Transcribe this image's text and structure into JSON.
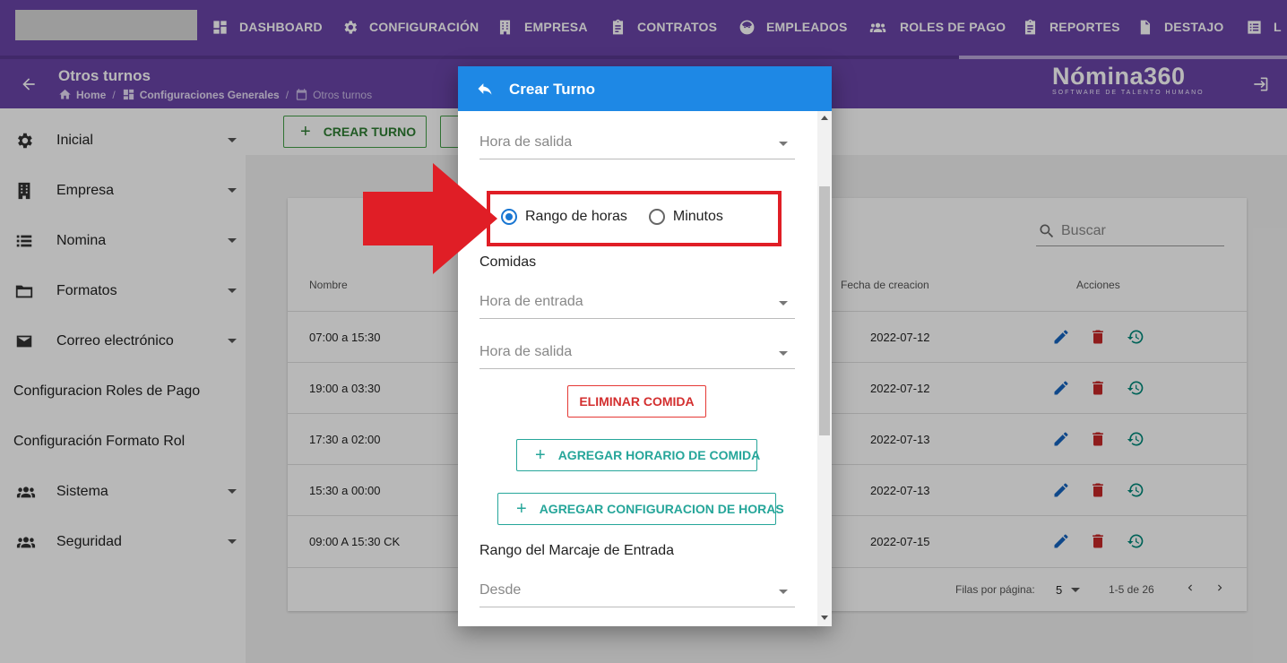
{
  "nav": {
    "items": [
      {
        "label": "DASHBOARD",
        "icon": "dashboard-icon"
      },
      {
        "label": "CONFIGURACIÓN",
        "icon": "gear-icon"
      },
      {
        "label": "EMPRESA",
        "icon": "building-icon"
      },
      {
        "label": "CONTRATOS",
        "icon": "clipboard-icon"
      },
      {
        "label": "EMPLEADOS",
        "icon": "face-icon"
      },
      {
        "label": "ROLES DE PAGO",
        "icon": "group-icon"
      },
      {
        "label": "REPORTES",
        "icon": "clipboard-icon"
      },
      {
        "label": "DESTAJO",
        "icon": "document-icon"
      },
      {
        "label": "L",
        "icon": "list-icon"
      }
    ]
  },
  "header": {
    "title": "Otros turnos",
    "breadcrumb": [
      "Home",
      "Configuraciones Generales",
      "Otros turnos"
    ],
    "brand_name": "Nómina360",
    "brand_sub": "SOFTWARE DE TALENTO HUMANO"
  },
  "sidebar": {
    "items": [
      {
        "label": "Inicial",
        "icon": "gear-icon",
        "expandable": true
      },
      {
        "label": "Empresa",
        "icon": "building-icon",
        "expandable": true
      },
      {
        "label": "Nomina",
        "icon": "list-icon",
        "expandable": true
      },
      {
        "label": "Formatos",
        "icon": "folder-icon",
        "expandable": true
      },
      {
        "label": "Correo electrónico",
        "icon": "mail-icon",
        "expandable": true
      },
      {
        "label": "Configuracion Roles de Pago",
        "icon": "",
        "expandable": false
      },
      {
        "label": "Configuración Formato Rol",
        "icon": "",
        "expandable": false
      },
      {
        "label": "Sistema",
        "icon": "group-icon",
        "expandable": true
      },
      {
        "label": "Seguridad",
        "icon": "group-icon",
        "expandable": true
      }
    ]
  },
  "toolbar": {
    "create_label": "CREAR TURNO"
  },
  "table": {
    "search_placeholder": "Buscar",
    "headers": {
      "name": "Nombre",
      "date": "Fecha de creacion",
      "actions": "Acciones"
    },
    "rows": [
      {
        "name": "07:00 a 15:30",
        "date": "2022-07-12"
      },
      {
        "name": "19:00 a 03:30",
        "date": "2022-07-12"
      },
      {
        "name": "17:30 a 02:00",
        "date": "2022-07-13"
      },
      {
        "name": "15:30 a 00:00",
        "date": "2022-07-13"
      },
      {
        "name": "09:00 A 15:30 CK",
        "date": "2022-07-15"
      }
    ],
    "footer": {
      "rows_label": "Filas por página:",
      "rows_value": "5",
      "range": "1-5 de 26"
    }
  },
  "dialog": {
    "title": "Crear Turno",
    "fields": {
      "salida_top": "Hora de salida",
      "entrada": "Hora de entrada",
      "salida": "Hora de salida",
      "desde": "Desde"
    },
    "radio": {
      "option1": "Rango de horas",
      "option2": "Minutos",
      "selected": "Rango de horas"
    },
    "comidas_label": "Comidas",
    "eliminar_label": "ELIMINAR COMIDA",
    "agregar_comida_label": "AGREGAR HORARIO DE COMIDA",
    "agregar_config_label": "AGREGAR CONFIGURACION DE HORAS",
    "rango_label": "Rango del Marcaje de Entrada"
  },
  "colors": {
    "nav_purple": "#6a45a8",
    "dialog_header": "#1e88e5",
    "highlight_red": "#e01e26",
    "edit_blue": "#1565c0",
    "delete_red": "#c62828",
    "history_teal": "#00897b"
  }
}
